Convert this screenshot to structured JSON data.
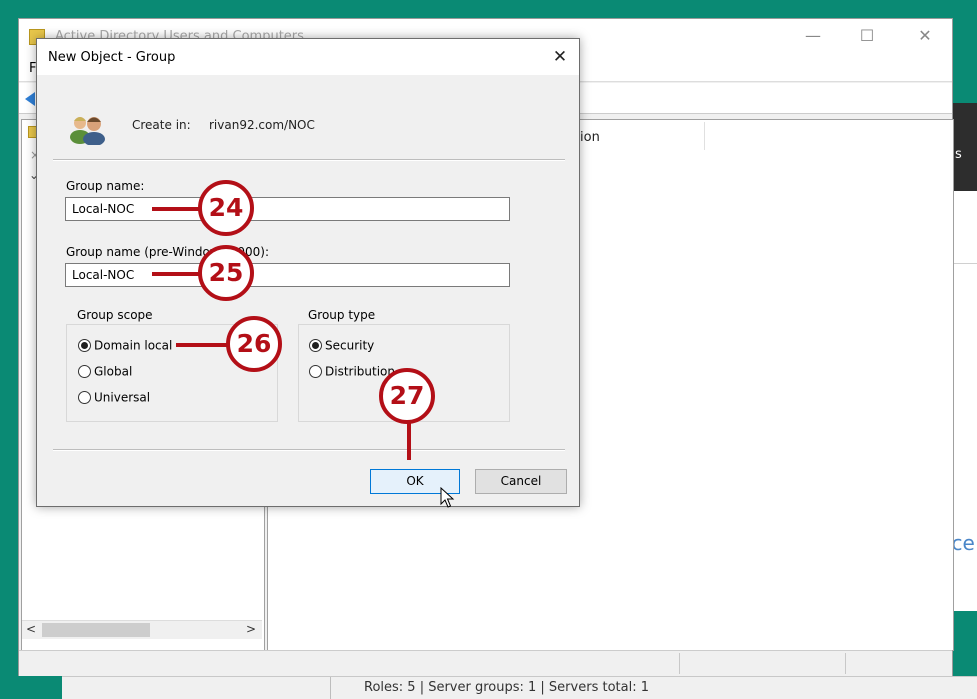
{
  "aduc_window": {
    "title": "Active Directory Users and Computers",
    "menu_first": "F",
    "column_header_partial": "ion",
    "tree_collapsed_glyph": "×",
    "tree_expanded_glyph": "⌄",
    "scroll_left_glyph": "<",
    "scroll_right_glyph": ">",
    "minimize_glyph": "—",
    "maximize_glyph": "☐",
    "close_glyph": "✕"
  },
  "server_manager": {
    "right_panel_partial_text": "s",
    "right_panel_partial_link": "ice",
    "status": "Roles: 5   |   Server groups: 1   |   Servers total: 1"
  },
  "dialog": {
    "title": "New Object - Group",
    "close_glyph": "✕",
    "create_in_label": "Create in:",
    "create_in_path": "rivan92.com/NOC",
    "group_name_label": "Group name:",
    "group_name_value": "Local-NOC",
    "group_name_prewin_label": "Group name (pre-Windows 2000):",
    "group_name_prewin_value": "Local-NOC",
    "group_scope": {
      "legend": "Group scope",
      "options": [
        "Domain local",
        "Global",
        "Universal"
      ],
      "selected": "Domain local"
    },
    "group_type": {
      "legend": "Group type",
      "options": [
        "Security",
        "Distribution"
      ],
      "selected": "Security"
    },
    "ok_label": "OK",
    "cancel_label": "Cancel"
  },
  "callouts": {
    "c24": "24",
    "c25": "25",
    "c26": "26",
    "c27": "27"
  },
  "colors": {
    "desktop": "#0a8a74",
    "callout": "#b30f17",
    "accent": "#0078d7"
  }
}
